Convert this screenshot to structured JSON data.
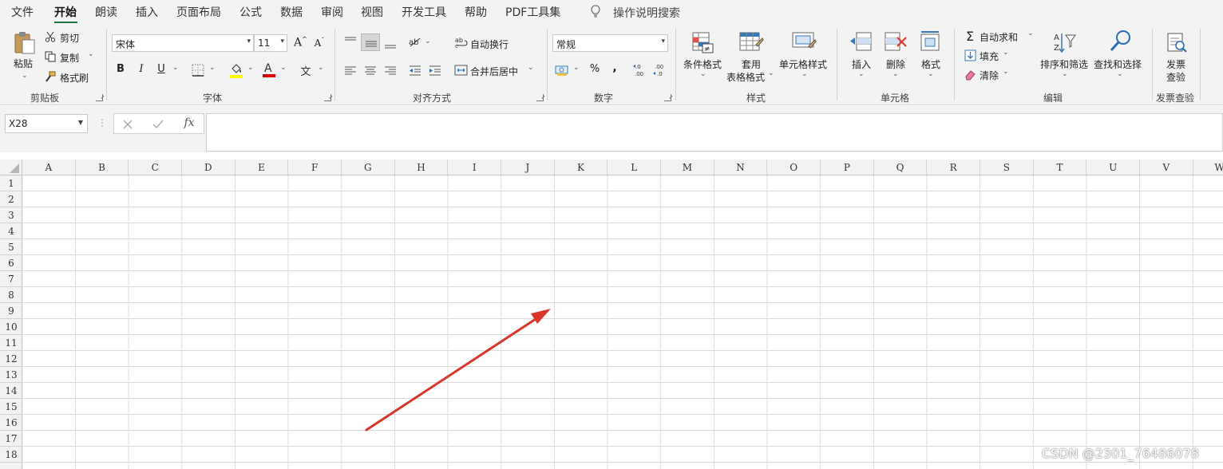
{
  "menu": {
    "tabs": [
      {
        "label": "文件"
      },
      {
        "label": "开始"
      },
      {
        "label": "朗读"
      },
      {
        "label": "插入"
      },
      {
        "label": "页面布局"
      },
      {
        "label": "公式"
      },
      {
        "label": "数据"
      },
      {
        "label": "审阅"
      },
      {
        "label": "视图"
      },
      {
        "label": "开发工具"
      },
      {
        "label": "帮助"
      },
      {
        "label": "PDF工具集"
      }
    ],
    "active_tab": "开始",
    "tell_me": "操作说明搜索"
  },
  "ribbon": {
    "clipboard": {
      "paste": "粘贴",
      "cut": "剪切",
      "copy": "复制",
      "format_painter": "格式刷",
      "label": "剪贴板"
    },
    "font": {
      "name": "宋体",
      "size": "11",
      "bold": "B",
      "italic": "I",
      "underline": "U",
      "font_color_letter": "A",
      "label": "字体"
    },
    "alignment": {
      "wrap_text": "自动换行",
      "merge_center": "合并后居中",
      "label": "对齐方式"
    },
    "number": {
      "format": "常规",
      "percent": "%",
      "comma": ",",
      "label": "数字"
    },
    "styles": {
      "conditional": "条件格式",
      "table_format_line1": "套用",
      "table_format_line2": "表格格式",
      "cell_styles": "单元格样式",
      "label": "样式"
    },
    "cells": {
      "insert": "插入",
      "delete": "删除",
      "format": "格式",
      "label": "单元格"
    },
    "editing": {
      "autosum": "自动求和",
      "fill": "填充",
      "clear": "清除",
      "sort_filter": "排序和筛选",
      "find_select": "查找和选择",
      "label": "编辑"
    },
    "invoice": {
      "check_line1": "发票",
      "check_line2": "查验",
      "label": "发票查验"
    }
  },
  "formula_bar": {
    "name_box": "X28",
    "fx": "fx",
    "value": ""
  },
  "sheet": {
    "columns": [
      "A",
      "B",
      "C",
      "D",
      "E",
      "F",
      "G",
      "H",
      "I",
      "J",
      "K",
      "L",
      "M",
      "N",
      "O",
      "P",
      "Q",
      "R",
      "S",
      "T",
      "U",
      "V",
      "W"
    ],
    "rows": [
      "1",
      "2",
      "3",
      "4",
      "5",
      "6",
      "7",
      "8",
      "9",
      "10",
      "11",
      "12",
      "13",
      "14",
      "15",
      "16",
      "17",
      "18"
    ]
  },
  "colors": {
    "accent": "#217346",
    "arrow": "#d9362b",
    "ribbon_bg": "#f3f3f3"
  },
  "watermark": "CSDN @2301_76486078"
}
